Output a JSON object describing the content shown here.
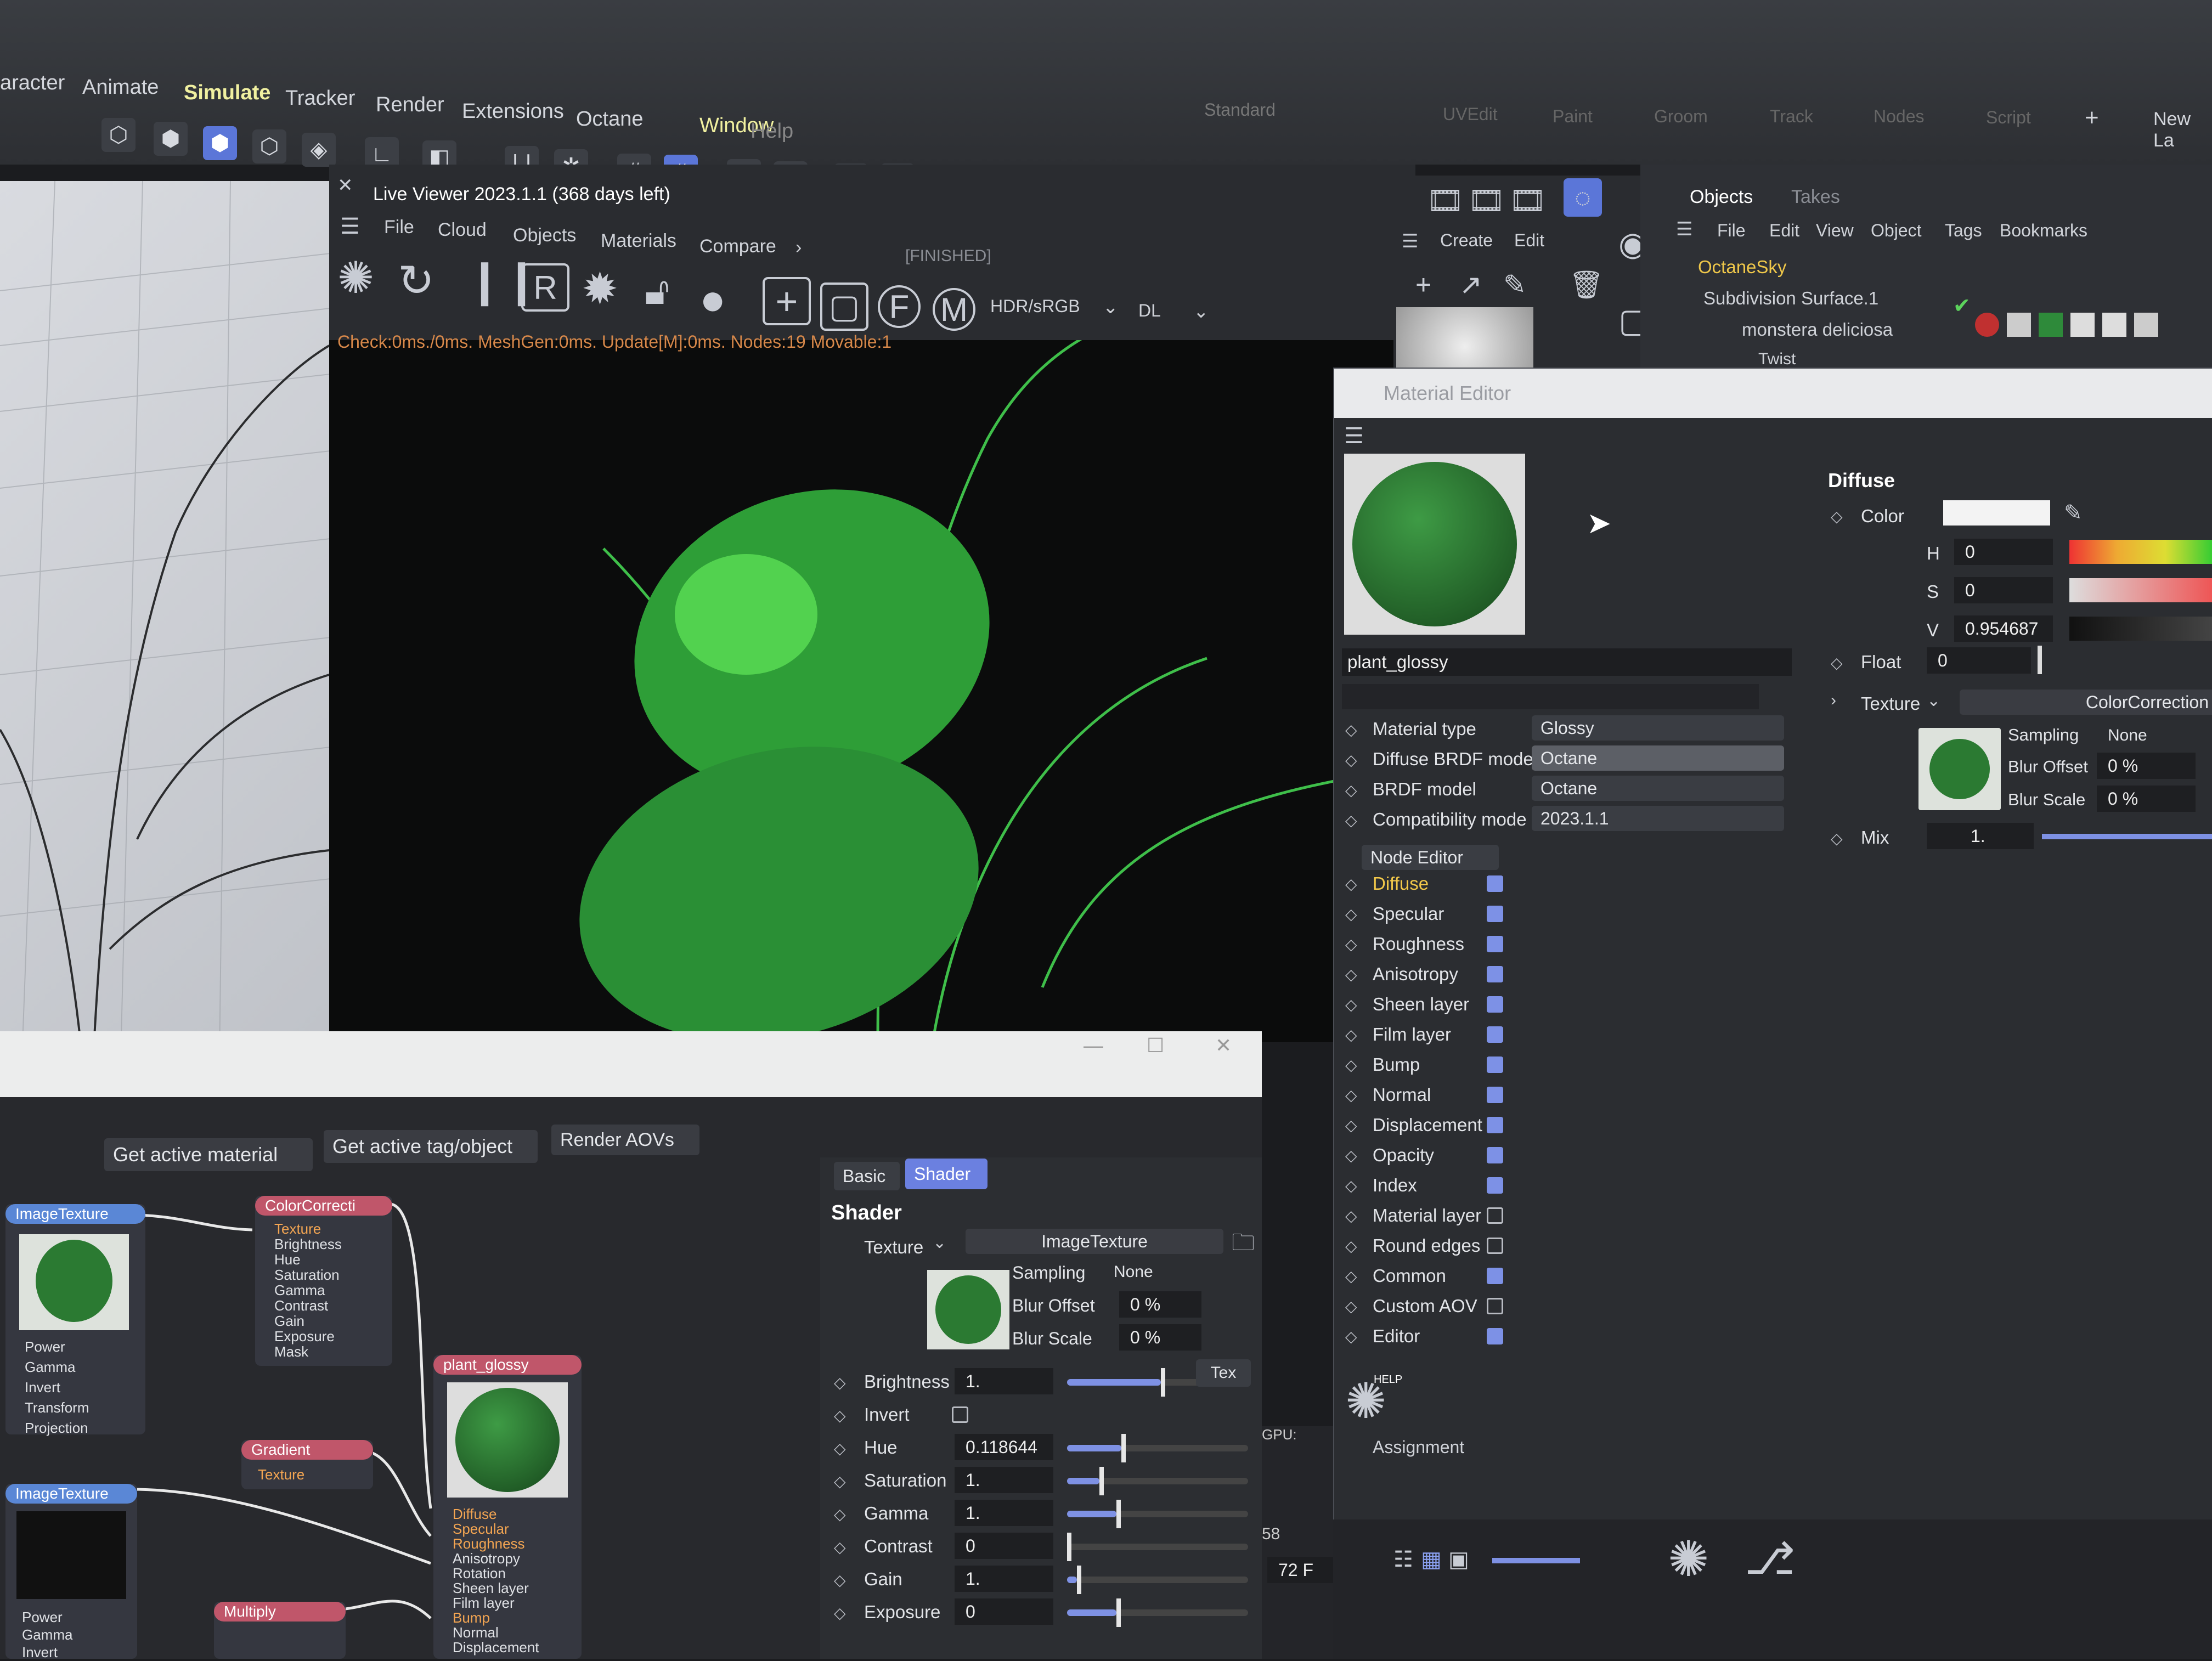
{
  "menubar": {
    "items": [
      "aracter",
      "Animate",
      "Simulate",
      "Tracker",
      "Render",
      "Extensions",
      "Octane",
      "Window",
      "Help"
    ],
    "active": "Simulate",
    "layouts": [
      "Standard",
      "UVEdit",
      "Paint",
      "Groom",
      "Track",
      "Nodes",
      "Script"
    ],
    "new_layout": "New La"
  },
  "live_viewer": {
    "title": "Live Viewer 2023.1.1 (368 days left)",
    "menu": [
      "File",
      "Cloud",
      "Objects",
      "Materials",
      "Compare"
    ],
    "status": "[FINISHED]",
    "colorspace": "HDR/sRGB",
    "mode": "DL",
    "stats": "Check:0ms./0ms. MeshGen:0ms. Update[M]:0ms. Nodes:19 Movable:1"
  },
  "secondary_toolbar": {
    "create": "Create",
    "edit": "Edit"
  },
  "objects_panel": {
    "tabs": [
      "Objects",
      "Takes"
    ],
    "menu": [
      "File",
      "Edit",
      "View",
      "Object",
      "Tags",
      "Bookmarks"
    ],
    "rows": [
      "OctaneSky",
      "Subdivision Surface.1",
      "monstera deliciosa",
      "Twist"
    ]
  },
  "material_editor": {
    "title": "Material Editor",
    "material_name": "plant_glossy",
    "props": [
      {
        "label": "Material type",
        "value": "Glossy"
      },
      {
        "label": "Diffuse BRDF model",
        "value": "Octane"
      },
      {
        "label": "BRDF model",
        "value": "Octane"
      },
      {
        "label": "Compatibility mode",
        "value": "2023.1.1"
      }
    ],
    "node_editor_btn": "Node Editor",
    "channels": [
      {
        "label": "Diffuse",
        "checked": true,
        "active": true
      },
      {
        "label": "Specular",
        "checked": true
      },
      {
        "label": "Roughness",
        "checked": true
      },
      {
        "label": "Anisotropy",
        "checked": true
      },
      {
        "label": "Sheen layer",
        "checked": true
      },
      {
        "label": "Film layer",
        "checked": true
      },
      {
        "label": "Bump",
        "checked": true
      },
      {
        "label": "Normal",
        "checked": true
      },
      {
        "label": "Displacement",
        "checked": true
      },
      {
        "label": "Opacity",
        "checked": true
      },
      {
        "label": "Index",
        "checked": true
      },
      {
        "label": "Material layer",
        "checked": false
      },
      {
        "label": "Round edges",
        "checked": false
      },
      {
        "label": "Common",
        "checked": true
      },
      {
        "label": "Custom AOV",
        "checked": false
      },
      {
        "label": "Editor",
        "checked": true
      }
    ],
    "assignment": "Assignment",
    "help": "HELP",
    "diffuse": {
      "heading": "Diffuse",
      "color_label": "Color",
      "h_label": "H",
      "h_value": "0",
      "s_label": "S",
      "s_value": "0",
      "v_label": "V",
      "v_value": "0.954687",
      "float_label": "Float",
      "float_value": "0",
      "texture_label": "Texture",
      "texture_value": "ColorCorrection",
      "sampling_label": "Sampling",
      "sampling_value": "None",
      "blur_offset_label": "Blur Offset",
      "blur_offset_value": "0 %",
      "blur_scale_label": "Blur Scale",
      "blur_scale_value": "0 %",
      "mix_label": "Mix",
      "mix_value": "1."
    }
  },
  "node_editor": {
    "buttons": [
      "Get active material",
      "Get active tag/object",
      "Render AOVs"
    ],
    "tabs": [
      "Basic",
      "Shader"
    ],
    "active_tab": "Shader",
    "nodes": {
      "image_texture_1": {
        "title": "ImageTexture",
        "ports": [
          "Power",
          "Gamma",
          "Invert",
          "Transform",
          "Projection"
        ]
      },
      "color_correction": {
        "title": "ColorCorrecti",
        "ports": [
          "Texture",
          "Brightness",
          "Hue",
          "Saturation",
          "Gamma",
          "Contrast",
          "Gain",
          "Exposure",
          "Mask"
        ]
      },
      "gradient": {
        "title": "Gradient",
        "ports": [
          "Texture"
        ]
      },
      "image_texture_2": {
        "title": "ImageTexture",
        "ports": [
          "Power",
          "Gamma",
          "Invert"
        ]
      },
      "multiply": {
        "title": "Multiply"
      },
      "plant_glossy": {
        "title": "plant_glossy",
        "ports": [
          "Diffuse",
          "Specular",
          "Roughness",
          "Anisotropy",
          "Rotation",
          "Sheen layer",
          "Film layer",
          "Bump",
          "Normal",
          "Displacement"
        ]
      }
    },
    "shader": {
      "heading": "Shader",
      "texture_label": "Texture",
      "texture_value": "ImageTexture",
      "sampling_label": "Sampling",
      "sampling_value": "None",
      "blur_offset_label": "Blur Offset",
      "blur_offset_value": "0 %",
      "blur_scale_label": "Blur Scale",
      "blur_scale_value": "0 %",
      "params": [
        {
          "label": "Brightness",
          "value": "1.",
          "level": 0.95
        },
        {
          "label": "Invert",
          "value": "",
          "level": 0
        },
        {
          "label": "Hue",
          "value": "0.118644",
          "level": 0.55
        },
        {
          "label": "Saturation",
          "value": "1.",
          "level": 0.33
        },
        {
          "label": "Gamma",
          "value": "1.",
          "level": 0.5
        },
        {
          "label": "Contrast",
          "value": "0",
          "level": 0
        },
        {
          "label": "Gain",
          "value": "1.",
          "level": 0.1
        },
        {
          "label": "Exposure",
          "value": "0",
          "level": 0.5
        }
      ],
      "tex_btn": "Tex"
    }
  },
  "timeline": {
    "frame_a": "58",
    "frame_b": "72",
    "current": "72 F",
    "gpu": "GPU:"
  },
  "colors": {
    "accent": "#5b76d8",
    "highlight": "#f0f0a0",
    "orange": "#f3a552"
  }
}
